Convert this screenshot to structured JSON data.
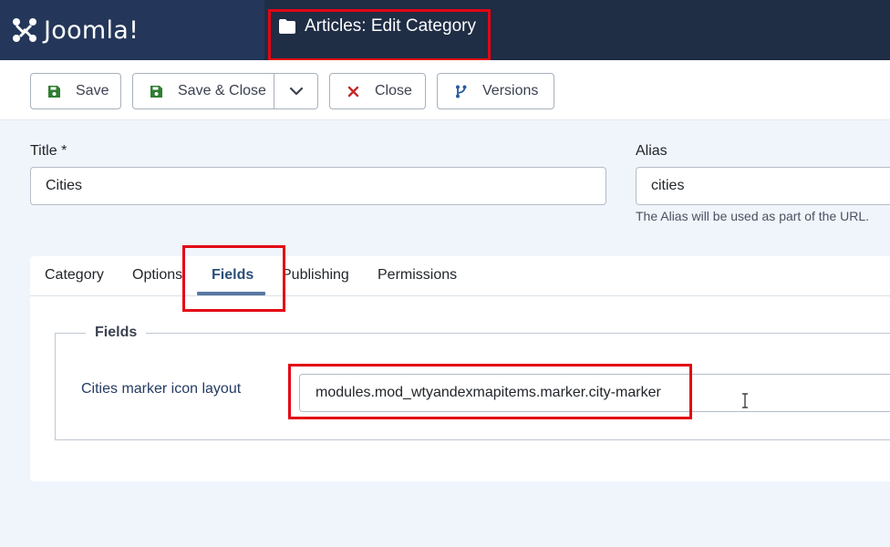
{
  "header": {
    "brand": "Joomla!",
    "page_title": "Articles: Edit Category"
  },
  "toolbar": {
    "save_label": "Save",
    "save_close_label": "Save & Close",
    "close_label": "Close",
    "versions_label": "Versions"
  },
  "form": {
    "title_label": "Title *",
    "title_value": "Cities",
    "alias_label": "Alias",
    "alias_value": "cities",
    "alias_help": "The Alias will be used as part of the URL."
  },
  "tabs": [
    {
      "label": "Category",
      "active": false
    },
    {
      "label": "Options",
      "active": false
    },
    {
      "label": "Fields",
      "active": true
    },
    {
      "label": "Publishing",
      "active": false
    },
    {
      "label": "Permissions",
      "active": false
    }
  ],
  "fields_panel": {
    "legend": "Fields",
    "field_label": "Cities marker icon layout",
    "field_value": "modules.mod_wtyandexmapitems.marker.city-marker"
  },
  "colors": {
    "header_bg": "#1f2d45",
    "brand_bg": "#24375a",
    "highlight": "#e30613",
    "save_icon": "#2f7d32",
    "close_icon": "#c52827",
    "versions_icon": "#2a5aa0"
  },
  "icons": [
    "joomla-logo",
    "folder-icon",
    "save-icon",
    "chevron-down-icon",
    "close-x-icon",
    "versions-branch-icon",
    "text-cursor-icon"
  ]
}
